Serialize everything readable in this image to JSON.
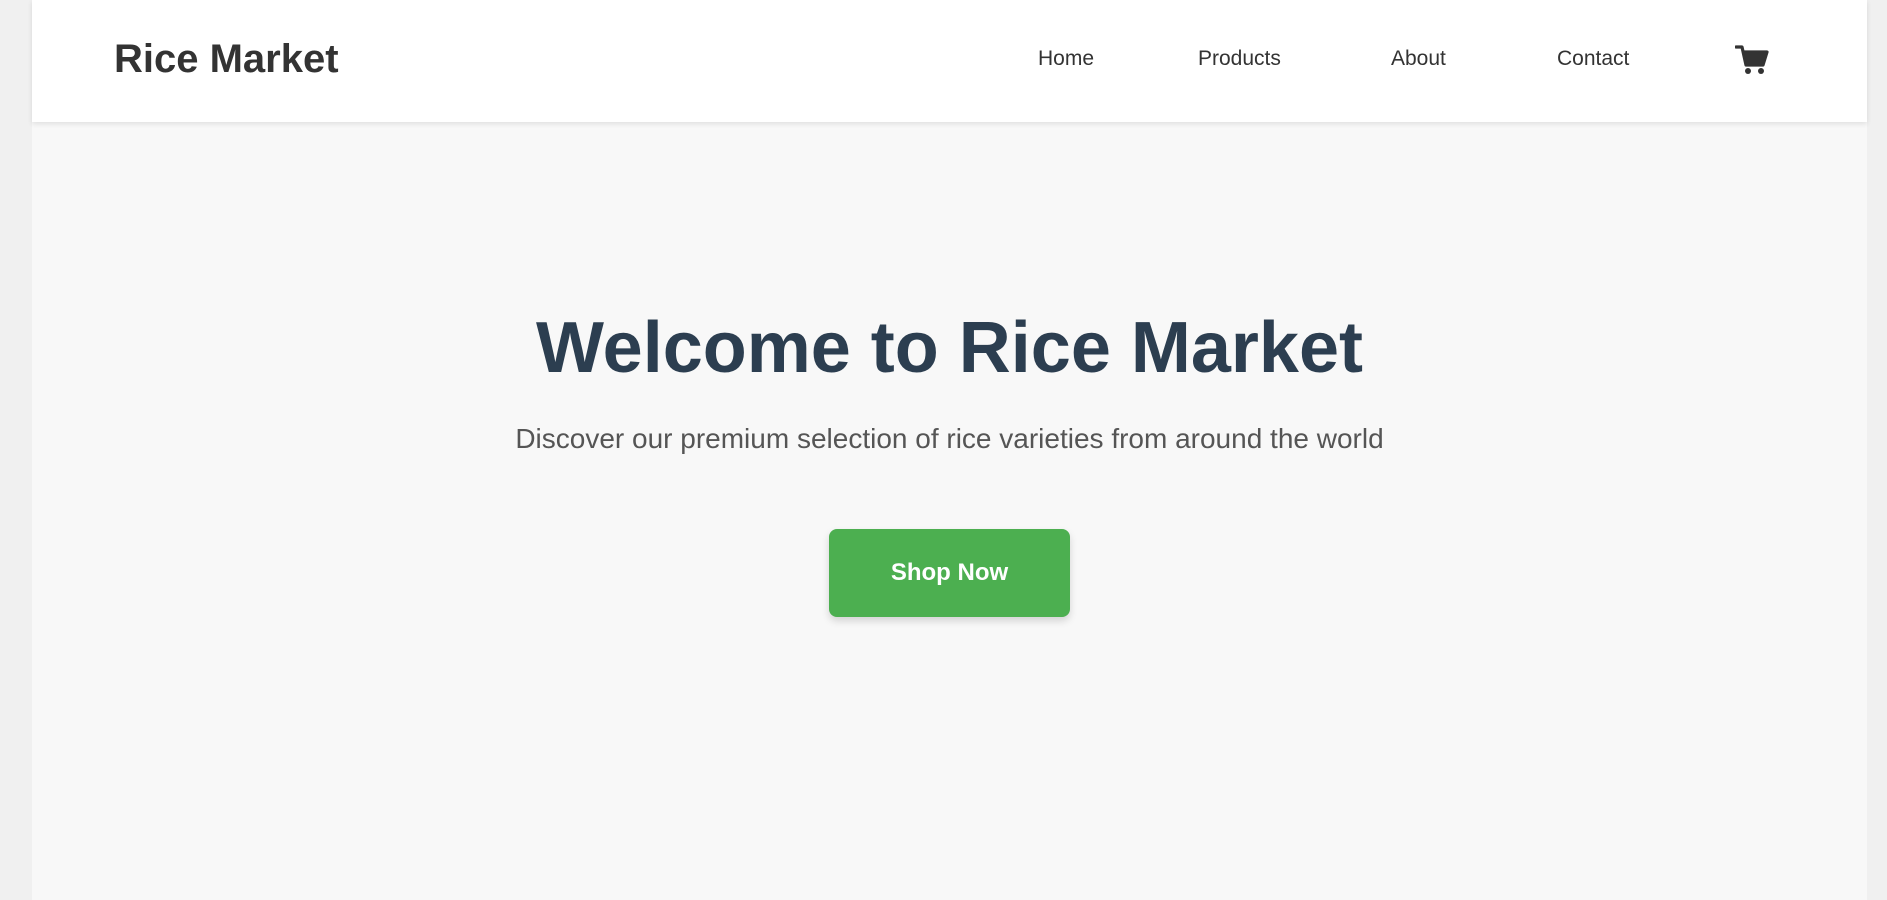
{
  "header": {
    "brand": "Rice Market",
    "nav": {
      "home": "Home",
      "products": "Products",
      "about": "About",
      "contact": "Contact"
    },
    "cart_icon": "shopping-cart-icon"
  },
  "hero": {
    "title": "Welcome to Rice Market",
    "subtitle": "Discover our premium selection of rice varieties from around the world",
    "cta_label": "Shop Now"
  },
  "colors": {
    "accent": "#4caf50",
    "title": "#2c3e50",
    "text": "#333333",
    "page_background": "#f8f8f8"
  }
}
